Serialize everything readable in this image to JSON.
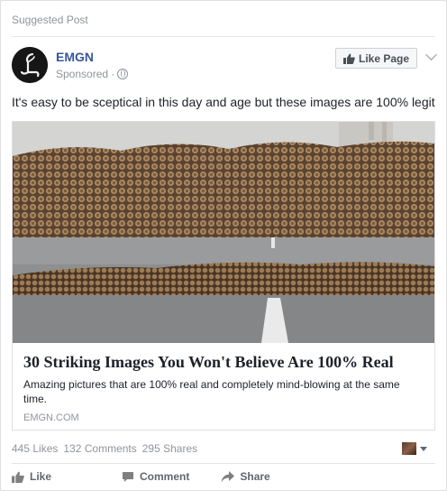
{
  "header": {
    "suggested_label": "Suggested Post"
  },
  "page": {
    "name": "EMGN",
    "sponsored_label": "Sponsored ·",
    "like_page_label": "Like Page"
  },
  "post": {
    "text": "It's easy to be sceptical in this day and age but these images are 100% legit"
  },
  "link": {
    "title": "30 Striking Images You Won't Believe Are 100% Real",
    "description": "Amazing pictures that are 100% real and completely mind-blowing at the same time.",
    "domain": "EMGN.COM"
  },
  "stats": {
    "likes": "445 Likes",
    "comments": "132 Comments",
    "shares": "295 Shares"
  },
  "actions": {
    "like": "Like",
    "comment": "Comment",
    "share": "Share"
  },
  "colors": {
    "link_blue": "#365899",
    "muted": "#90949c",
    "text": "#1d2129"
  },
  "icons": [
    "logo-icon",
    "globe-icon",
    "thumbs-up-icon",
    "chevron-down-icon",
    "comment-icon",
    "share-arrow-icon",
    "caret-down-icon"
  ]
}
